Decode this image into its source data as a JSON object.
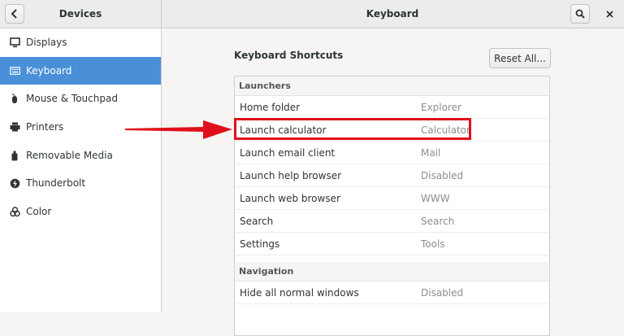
{
  "sidebar": {
    "title": "Devices",
    "items": [
      {
        "label": "Displays",
        "icon": "display-icon"
      },
      {
        "label": "Keyboard",
        "icon": "keyboard-icon",
        "active": true
      },
      {
        "label": "Mouse & Touchpad",
        "icon": "mouse-icon"
      },
      {
        "label": "Printers",
        "icon": "printer-icon"
      },
      {
        "label": "Removable Media",
        "icon": "usb-icon"
      },
      {
        "label": "Thunderbolt",
        "icon": "thunderbolt-icon"
      },
      {
        "label": "Color",
        "icon": "color-icon"
      }
    ]
  },
  "header": {
    "title": "Keyboard"
  },
  "main": {
    "section_title": "Keyboard Shortcuts",
    "reset_label": "Reset All...",
    "groups": [
      {
        "title": "Launchers",
        "rows": [
          {
            "name": "Home folder",
            "accel": "Explorer"
          },
          {
            "name": "Launch calculator",
            "accel": "Calculator"
          },
          {
            "name": "Launch email client",
            "accel": "Mail"
          },
          {
            "name": "Launch help browser",
            "accel": "Disabled"
          },
          {
            "name": "Launch web browser",
            "accel": "WWW"
          },
          {
            "name": "Search",
            "accel": "Search"
          },
          {
            "name": "Settings",
            "accel": "Tools"
          }
        ]
      },
      {
        "title": "Navigation",
        "rows": [
          {
            "name": "Hide all normal windows",
            "accel": "Disabled"
          }
        ]
      }
    ]
  },
  "colors": {
    "accent": "#4a90d9",
    "annotation": "#e0101a"
  }
}
